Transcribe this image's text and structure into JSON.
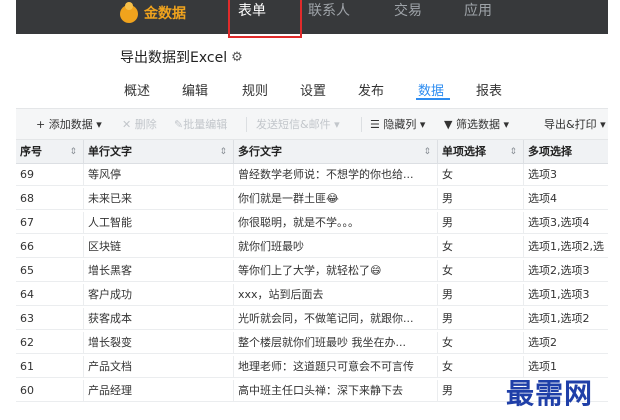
{
  "top_nav": {
    "logo_text": "金数据",
    "items": [
      "表单",
      "联系人",
      "交易",
      "应用"
    ],
    "active": "表单"
  },
  "page_title": "导出数据到Excel",
  "tabs": [
    "概述",
    "编辑",
    "规则",
    "设置",
    "发布",
    "数据",
    "报表"
  ],
  "active_tab": "数据",
  "toolbar": {
    "add_data": "+ 添加数据 ▾",
    "delete": "✕ 删除",
    "batch_edit": "批量编辑",
    "send_sms_email": "发送短信&邮件 ▾",
    "hide_columns": "隐藏列 ▾",
    "filter_data": "筛选数据 ▾",
    "export_print": "导出&打印 ▾"
  },
  "table": {
    "columns": [
      "序号",
      "单行文字",
      "多行文字",
      "单项选择",
      "多项选择"
    ],
    "rows": [
      [
        "69",
        "等风停",
        "曾经数学老师说：不想学的你也给...",
        "女",
        "选项3"
      ],
      [
        "68",
        "未来已来",
        "你们就是一群土匪😂",
        "男",
        "选项4"
      ],
      [
        "67",
        "人工智能",
        "你很聪明，就是不学。。。",
        "男",
        "选项3,选项4"
      ],
      [
        "66",
        "区块链",
        "就你们班最吵",
        "女",
        "选项1,选项2,选"
      ],
      [
        "65",
        "增长黑客",
        "等你们上了大学，就轻松了😄",
        "女",
        "选项2,选项3"
      ],
      [
        "64",
        "客户成功",
        "xxx，站到后面去",
        "男",
        "选项1,选项3"
      ],
      [
        "63",
        "获客成本",
        "光听就会同，不做笔记同，就跟你...",
        "男",
        "选项1,选项2"
      ],
      [
        "62",
        "增长裂变",
        "整个楼层就你们班最吵 我坐在办...",
        "女",
        "选项2"
      ],
      [
        "61",
        "产品文档",
        "地理老师：这道题只可意会不可言传",
        "女",
        "选项1"
      ],
      [
        "60",
        "产品经理",
        "高中班主任口头禅：深下来静下去",
        "男",
        ""
      ]
    ]
  },
  "watermark": "最需网",
  "colors": {
    "topbar_bg": "#37393b",
    "logo_accent": "#f0a31d",
    "active_tab": "#2d8cf0",
    "highlight_box": "#e02b2b",
    "watermark": "#1f3fa8"
  }
}
